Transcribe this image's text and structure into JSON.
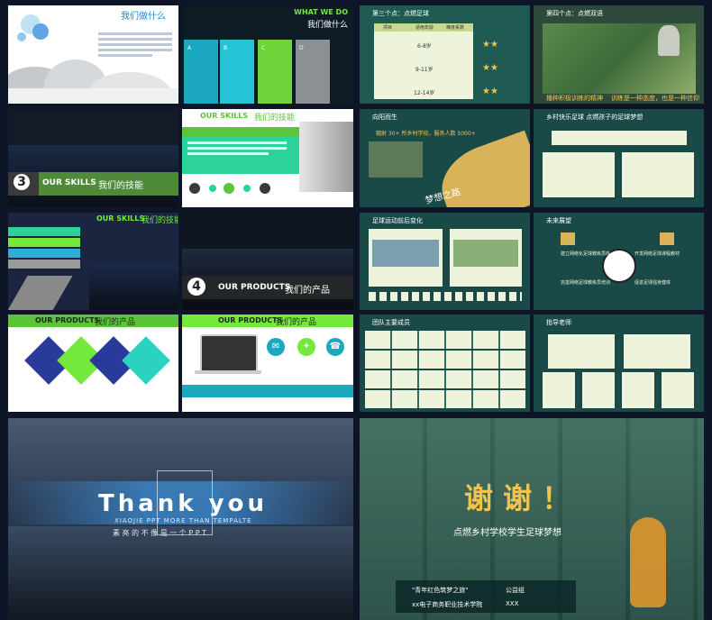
{
  "slides": {
    "s1": {
      "title": "我们做什么"
    },
    "s2": {
      "title_en": "WHAT WE DO",
      "title_cn": "我们做什么",
      "tab_labels": [
        "A",
        "B",
        "C",
        "D"
      ]
    },
    "s3": {
      "title": "第三个点：点燃足球",
      "header": [
        "项目",
        "适用年龄",
        "难度系数"
      ],
      "rows": [
        "6-8岁",
        "9-11岁",
        "12-14岁"
      ]
    },
    "s4": {
      "title": "第四个点：点燃双语",
      "caption1": "播种积极训练的精神",
      "caption2": "训练是一种态度，也是一种信仰"
    },
    "s5": {
      "number": "3",
      "title_en": "OUR SKILLS",
      "title_cn": "我们的技能"
    },
    "s6": {
      "title_en": "OUR SKILLS",
      "title_cn": "我们的技能"
    },
    "s7": {
      "title": "向阳而生",
      "subtitle": "辐射 30+ 所乡村学校，服务人数 5000+",
      "road_text": "梦想之路"
    },
    "s8": {
      "title": "乡村快乐足球 点燃孩子的足球梦想"
    },
    "s9": {
      "title_en": "OUR SKILLS",
      "title_cn": "我们的技能"
    },
    "s10": {
      "number": "4",
      "title_en": "OUR PRODUCTS",
      "title_cn": "我们的产品"
    },
    "s11": {
      "title": "足球运动前后变化"
    },
    "s12": {
      "title": "未来展望",
      "items": [
        "建立网络化足球教练员库",
        "开发网络足球课程教材",
        "完善网络足球教练员培训",
        "促进足球强身健体"
      ]
    },
    "s13": {
      "title_en": "OUR PRODUCTS",
      "title_cn": "我们的产品"
    },
    "s14": {
      "title_en": "OUR PRODUCTS",
      "title_cn": "我们的产品"
    },
    "s15": {
      "title": "团队主要成员"
    },
    "s16": {
      "title": "指导老师"
    },
    "s17": {
      "title": "Thank you",
      "sub1": "XIAOJIE PPT MORE THAN TEMPALTE",
      "sub2": "素 亮 的 不 像 是 一 个 P P T"
    },
    "s18": {
      "title": "谢  谢  ！",
      "subtitle": "点燃乡村学校学生足球梦想",
      "line1": "\"青年红色筑梦之旅\"",
      "line1b": "公益组",
      "line2": "xx电子商务职业技术学院",
      "line2b": "XXX"
    }
  },
  "colors": {
    "green": "#74e83b",
    "teal": "#1c9fb4",
    "navy": "#1d2a4a",
    "gold": "#f3c44b",
    "dark_green": "#1a4a47"
  }
}
